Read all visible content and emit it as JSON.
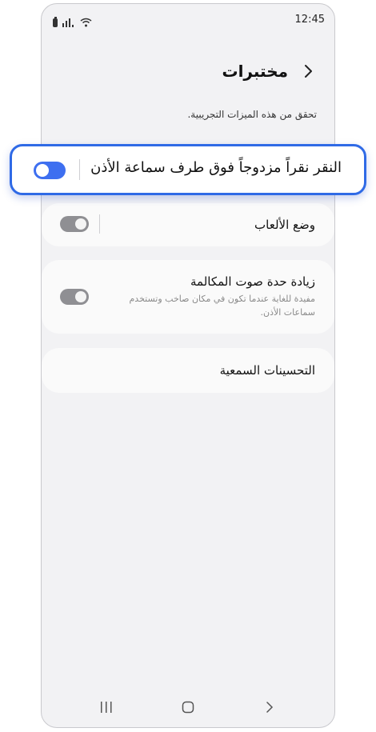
{
  "status": {
    "time": "12:45",
    "icons": [
      "battery-icon",
      "signal-icon",
      "wifi-icon"
    ]
  },
  "header": {
    "title": "مختبرات",
    "back_icon": "chevron-back-icon"
  },
  "description": "تحقق من هذه الميزات التجريبية.",
  "highlighted": {
    "label": "النقر نقراً مزدوجاً فوق طرف سماعة الأذن",
    "toggle": "on"
  },
  "items": [
    {
      "title": "وضع الألعاب",
      "toggle": "off"
    },
    {
      "title": "زيادة حدة صوت المكالمة",
      "subtitle": "مفيدة للغاية عندما تكون في مكان صاخب وتستخدم سماعات الأذن.",
      "toggle": "off"
    },
    {
      "title": "التحسينات السمعية"
    }
  ],
  "navbar": {
    "icons": [
      "recent-apps-icon",
      "home-icon",
      "back-icon"
    ]
  },
  "colors": {
    "accent": "#3e6ff0",
    "highlight_border": "#2f6ae6",
    "background": "#f2f2f4"
  }
}
